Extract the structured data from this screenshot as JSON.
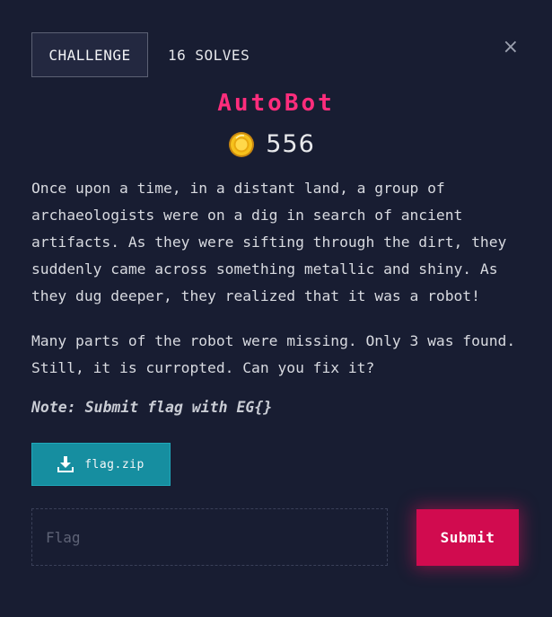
{
  "tabs": {
    "challenge": "CHALLENGE",
    "solves": "16 SOLVES"
  },
  "close": {
    "icon": "close-icon",
    "glyph": "×"
  },
  "challenge": {
    "title": "AutoBot",
    "points": "556",
    "points_icon": "coin-icon",
    "description": [
      "Once upon a time, in a distant land, a group of archaeologists were on a dig in search of ancient artifacts. As they were sifting through the dirt, they suddenly came across something metallic and shiny. As they dug deeper, they realized that it was a robot!",
      "Many parts of the robot were missing. Only 3 was found. Still, it is curropted. Can you fix it?"
    ],
    "note": "Note: Submit flag with EG{}"
  },
  "download": {
    "icon": "download-icon",
    "label": "flag.zip"
  },
  "form": {
    "flag_placeholder": "Flag",
    "flag_value": "",
    "submit_label": "Submit"
  },
  "colors": {
    "background": "#181d32",
    "title": "#ff2d7c",
    "download_button": "#168ea0",
    "submit_button": "#d10b4f"
  }
}
